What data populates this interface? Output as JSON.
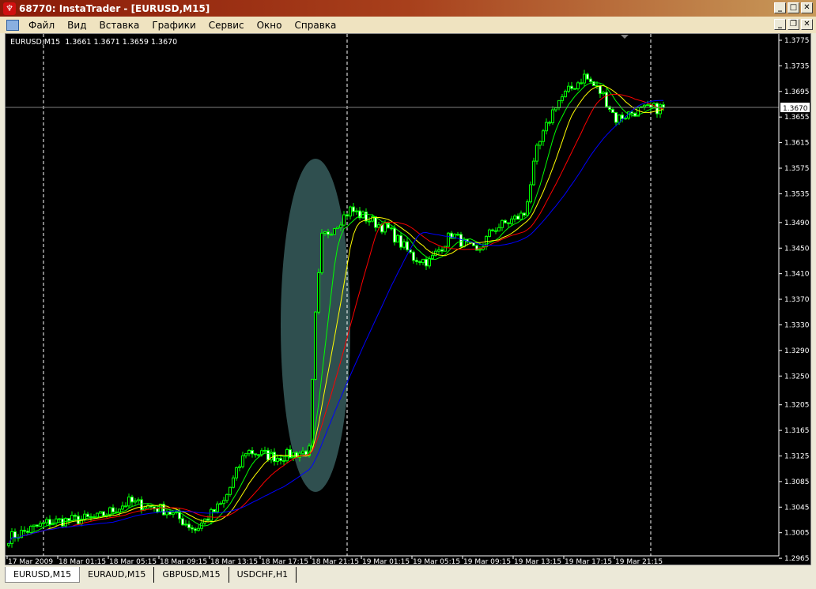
{
  "window": {
    "title": "68770: InstaTrader - [EURUSD,M15]"
  },
  "menu": [
    "Файл",
    "Вид",
    "Вставка",
    "Графики",
    "Сервис",
    "Окно",
    "Справка"
  ],
  "chart_header": "EURUSD,M15  1.3661 1.3671 1.3659 1.3670",
  "tabs": [
    "EURUSD,M15",
    "EURAUD,M15",
    "GBPUSD,M15",
    "USDCHF,H1"
  ],
  "colors": {
    "candle": "#00ff00",
    "ma_fast": "#00ff00",
    "ma_mid": "#ffff00",
    "ma_slow": "#ff0000",
    "ma_long": "#0000ff",
    "highlight": "#2f4f4f",
    "price_line": "#808080"
  },
  "chart_data": {
    "type": "candlestick",
    "symbol": "EURUSD",
    "timeframe": "M15",
    "ylim": [
      1.2945,
      1.379
    ],
    "y_ticks": [
      "1.3775",
      "1.3735",
      "1.3695",
      "1.3655",
      "1.3615",
      "1.3575",
      "1.3535",
      "1.3490",
      "1.3450",
      "1.3410",
      "1.3370",
      "1.3330",
      "1.3290",
      "1.3250",
      "1.3205",
      "1.3165",
      "1.3125",
      "1.3085",
      "1.3045",
      "1.3005",
      "1.2965"
    ],
    "x_ticks": [
      "17 Mar 2009",
      "18 Mar 01:15",
      "18 Mar 05:15",
      "18 Mar 09:15",
      "18 Mar 13:15",
      "18 Mar 17:15",
      "18 Mar 21:15",
      "19 Mar 01:15",
      "19 Mar 05:15",
      "19 Mar 09:15",
      "19 Mar 13:15",
      "19 Mar 17:15",
      "19 Mar 21:15"
    ],
    "bars_per_x_tick": 16,
    "current_price": "1.3670",
    "day_separators_bar": [
      11,
      107,
      203
    ],
    "price_path_anchors": [
      [
        0,
        1.2997
      ],
      [
        13,
        1.3022
      ],
      [
        28,
        1.3028
      ],
      [
        38,
        1.3053
      ],
      [
        50,
        1.304
      ],
      [
        59,
        1.301
      ],
      [
        68,
        1.3053
      ],
      [
        75,
        1.3133
      ],
      [
        85,
        1.3123
      ],
      [
        95,
        1.3133
      ],
      [
        97,
        1.3343
      ],
      [
        99,
        1.3466
      ],
      [
        103,
        1.3485
      ],
      [
        108,
        1.351
      ],
      [
        113,
        1.3497
      ],
      [
        120,
        1.3479
      ],
      [
        128,
        1.3435
      ],
      [
        133,
        1.3429
      ],
      [
        140,
        1.3472
      ],
      [
        148,
        1.3442
      ],
      [
        153,
        1.3479
      ],
      [
        163,
        1.3503
      ],
      [
        167,
        1.3602
      ],
      [
        173,
        1.3676
      ],
      [
        182,
        1.3719
      ],
      [
        188,
        1.3689
      ],
      [
        192,
        1.3652
      ],
      [
        198,
        1.3664
      ],
      [
        207,
        1.367
      ]
    ],
    "moving_averages": [
      {
        "period": 8,
        "color": "#00ff00"
      },
      {
        "period": 13,
        "color": "#ffff00"
      },
      {
        "period": 21,
        "color": "#ff0000"
      },
      {
        "period": 34,
        "color": "#0000ff"
      }
    ],
    "highlight_ellipse_bars": [
      86,
      108
    ]
  }
}
